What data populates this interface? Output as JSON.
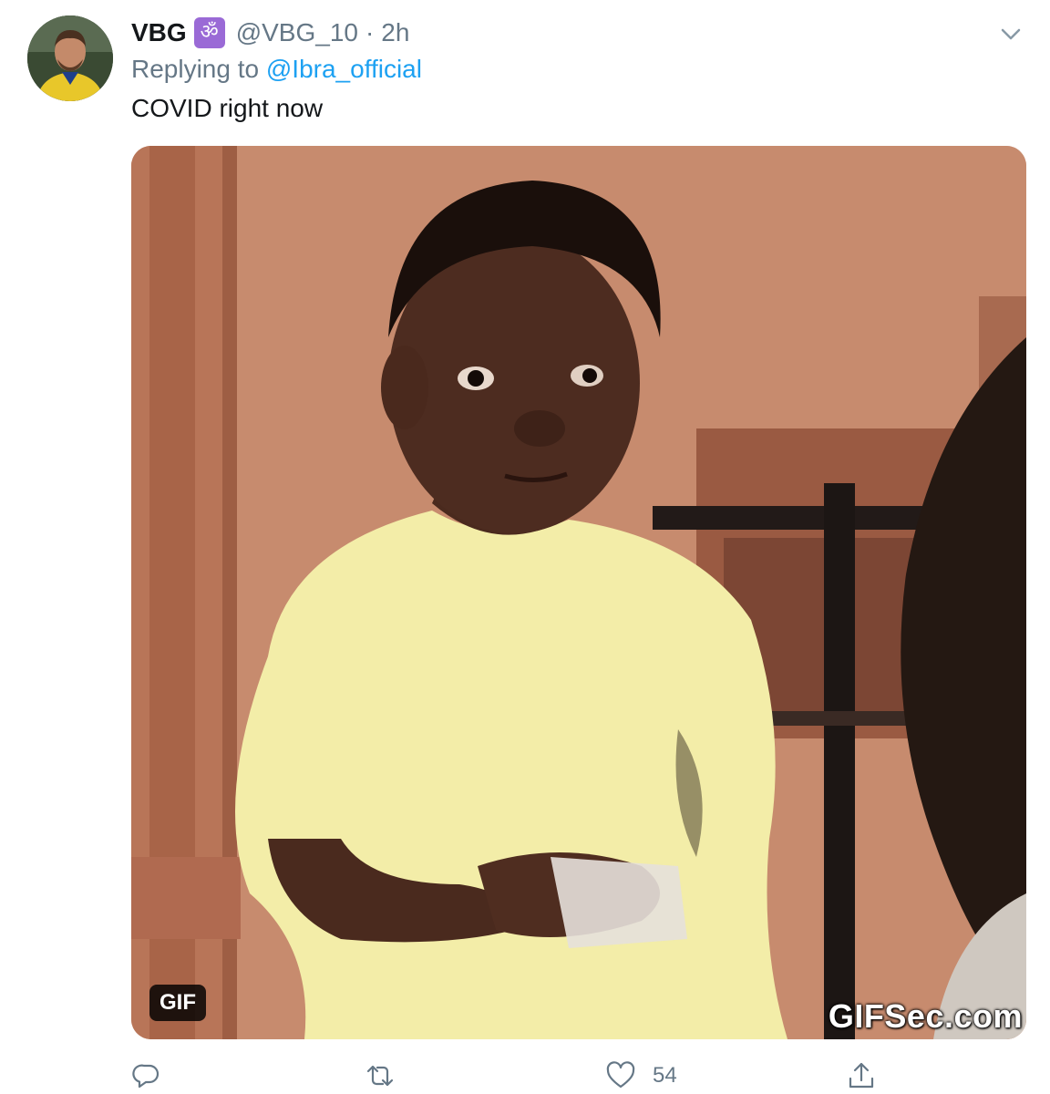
{
  "tweet": {
    "display_name": "VBG",
    "badge_glyph": "ॐ",
    "handle": "@VBG_10",
    "separator": "·",
    "time": "2h",
    "reply_prefix": "Replying to",
    "reply_to": "@Ibra_official",
    "text": "COVID right now"
  },
  "media": {
    "badge": "GIF",
    "watermark": "GIFSec.com"
  },
  "actions": {
    "reply": {
      "icon": "reply-icon",
      "count": ""
    },
    "retweet": {
      "icon": "retweet-icon",
      "count": ""
    },
    "like": {
      "icon": "heart-icon",
      "count": "54"
    },
    "share": {
      "icon": "share-icon",
      "count": ""
    }
  },
  "colors": {
    "link": "#1da1f2",
    "secondary": "#657786",
    "badge": "#9a6ad6"
  }
}
